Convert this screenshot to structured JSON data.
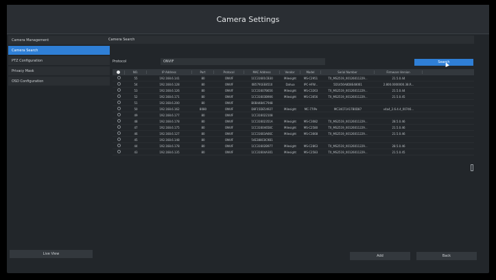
{
  "window": {
    "title": "Camera Settings"
  },
  "sidebar": {
    "items": [
      {
        "label": "Camera Management",
        "active": false
      },
      {
        "label": "Camera Search",
        "active": true
      },
      {
        "label": "PTZ Configuration",
        "active": false
      },
      {
        "label": "Privacy Mask",
        "active": false
      },
      {
        "label": "OSD Configuration",
        "active": false
      }
    ],
    "live_view_label": "Live View"
  },
  "main": {
    "section_title": "Camera Search",
    "protocol_label": "Protocol",
    "protocol_value": "ONVIF",
    "search_label": "Search",
    "columns": [
      "",
      "NO.",
      "IP Address",
      "Port",
      "Protocol",
      "MAC Address",
      "Vendor",
      "Model",
      "Serial Number",
      "Firmware Version"
    ],
    "rows": [
      [
        "",
        "55",
        "192.168.6.141",
        "80",
        "ONVIF",
        "1CC31601CB30",
        "Milesight",
        "MS-C2951",
        "TX_MS2519_X0126011229...",
        "21.5.0.44"
      ],
      [
        "",
        "54",
        "192.168.6.128",
        "80",
        "ONVIF",
        "0B5791EE8510",
        "Dahua",
        "IPC-HFW...",
        "5D1456A8D8E48061",
        "2.800.0000000.38.R..."
      ],
      [
        "",
        "53",
        "192.168.6.126",
        "80",
        "ONVIF",
        "1CC31607B656",
        "Milesight",
        "MS-C3263",
        "TX_MS2519_X0126011229...",
        "21.5.0.44"
      ],
      [
        "",
        "52",
        "192.168.6.171",
        "80",
        "ONVIF",
        "1CC31603B906",
        "Milesight",
        "MS-C3656",
        "TX_MS2519_X0126011229...",
        "21.5.0.45"
      ],
      [
        "",
        "51",
        "192.168.6.200",
        "80",
        "ONVIF",
        "B0B4484C7948",
        "",
        "",
        "",
        ""
      ],
      [
        "",
        "50",
        "192.168.6.162",
        "8080",
        "ONVIF",
        "D8F15DE54927",
        "Milesight",
        "MC-77IPe",
        "MC34CF1A17B0D87",
        "v4a4_2.6.4.4_00746..."
      ],
      [
        "",
        "49",
        "192.168.6.177",
        "80",
        "ONVIF",
        "1CC316022108",
        "",
        "",
        "",
        ""
      ],
      [
        "",
        "48",
        "192.168.6.178",
        "80",
        "ONVIF",
        "1CC31602351A",
        "Milesight",
        "MS-C3082",
        "TX_MS2519_X0126011229...",
        "28.5.0.46"
      ],
      [
        "",
        "47",
        "192.168.6.175",
        "80",
        "ONVIF",
        "1CC31604658C",
        "Milesight",
        "MS-C2580",
        "TX_MS2519_X0126011229...",
        "21.5.0.46"
      ],
      [
        "",
        "46",
        "192.168.6.127",
        "80",
        "ONVIF",
        "1CC31603A66C",
        "Milesight",
        "MS-C3668",
        "TX_MS2519_X0126011229...",
        "21.5.0.46"
      ],
      [
        "",
        "45",
        "192.168.6.148",
        "80",
        "ONVIF",
        "54E388C8C9B1",
        "",
        "",
        "",
        ""
      ],
      [
        "",
        "44",
        "192.168.6.178",
        "80",
        "ONVIF",
        "1CC31602B977",
        "Milesight",
        "MS-C2863",
        "TX_MS2519_X0126011229...",
        "28.5.0.46"
      ],
      [
        "",
        "43",
        "192.168.6.135",
        "80",
        "ONVIF",
        "1CC31604A301",
        "Milesight",
        "MS-C2583",
        "TX_MS2519_X0126011229...",
        "21.5.0.45"
      ]
    ]
  },
  "footer": {
    "add_label": "Add",
    "back_label": "Back"
  },
  "colors": {
    "accent": "#2f7fd6",
    "panel": "#22262a",
    "background": "#000000"
  }
}
